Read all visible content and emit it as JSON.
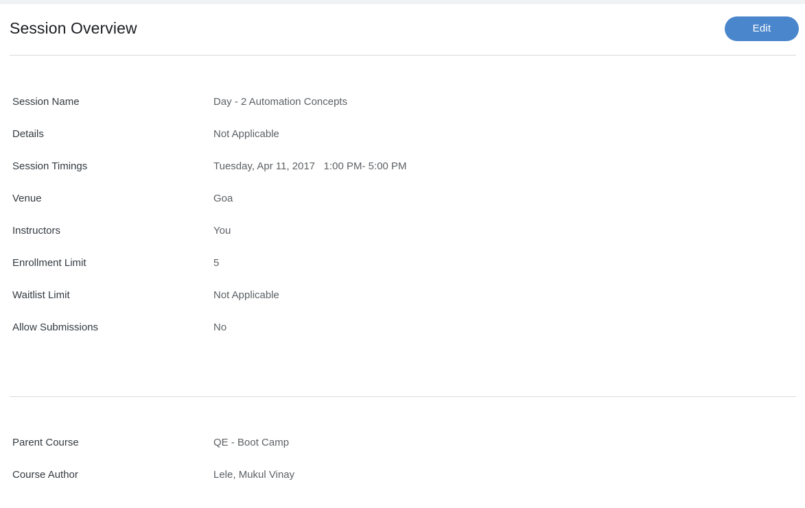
{
  "header": {
    "title": "Session Overview",
    "edit_label": "Edit",
    "accent_color": "#4a86cb"
  },
  "colors": {
    "label_text": "#343a40",
    "value_text": "#5c6064",
    "divider": "#d8d9da",
    "top_strip": "#f1f2f3",
    "background": "#ffffff"
  },
  "session_details": [
    {
      "label": "Session Name",
      "value": "Day - 2 Automation Concepts"
    },
    {
      "label": "Details",
      "value": "Not Applicable"
    },
    {
      "label": "Session Timings",
      "value": "Tuesday, Apr 11, 2017   1:00 PM- 5:00 PM"
    },
    {
      "label": "Venue",
      "value": "Goa"
    },
    {
      "label": "Instructors",
      "value": "You"
    },
    {
      "label": "Enrollment Limit",
      "value": "5"
    },
    {
      "label": "Waitlist Limit",
      "value": "Not Applicable"
    },
    {
      "label": "Allow Submissions",
      "value": "No"
    }
  ],
  "course_details": [
    {
      "label": "Parent Course",
      "value": "QE - Boot Camp"
    },
    {
      "label": "Course Author",
      "value": "Lele, Mukul Vinay"
    }
  ]
}
